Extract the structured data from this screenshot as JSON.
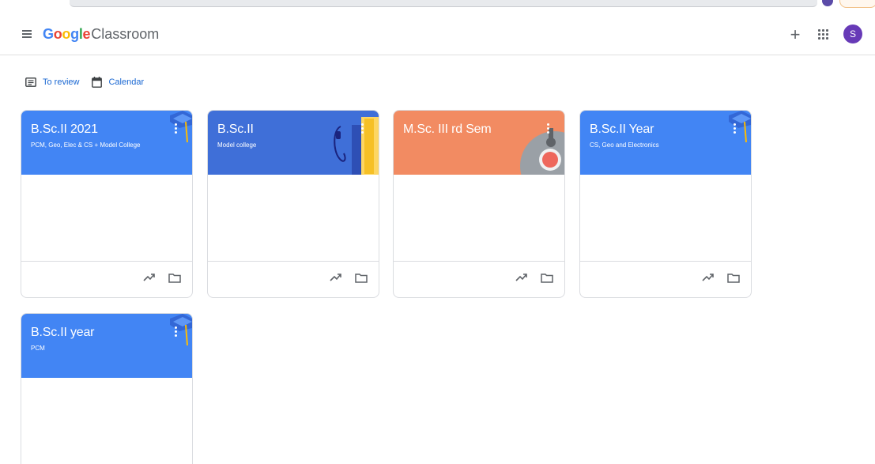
{
  "app": {
    "logo_google": [
      "G",
      "o",
      "o",
      "g",
      "l",
      "e"
    ],
    "logo_product": "Classroom",
    "avatar_initial": "S"
  },
  "subnav": {
    "to_review": "To review",
    "calendar": "Calendar"
  },
  "icons": {
    "menu": "menu-icon",
    "add": "plus-icon",
    "apps": "apps-grid-icon",
    "to_review": "list-icon",
    "calendar": "calendar-icon",
    "more": "more-vert-icon",
    "trend": "trending-up-icon",
    "folder": "folder-icon"
  },
  "colors": {
    "accent": "#1967d2",
    "avatar": "#673ab7",
    "card_blue": "#4285f4",
    "card_indigo": "#3f6fd8",
    "card_orange": "#f28b62"
  },
  "courses": [
    {
      "title": "B.Sc.II 2021",
      "subtitle": "PCM, Geo, Elec & CS + Model College"
    },
    {
      "title": "B.Sc.II",
      "subtitle": "Model college"
    },
    {
      "title": "M.Sc. III rd Sem",
      "subtitle": ""
    },
    {
      "title": "B.Sc.II Year",
      "subtitle": "CS, Geo and Electronics"
    },
    {
      "title": "B.Sc.II year",
      "subtitle": "PCM"
    }
  ]
}
